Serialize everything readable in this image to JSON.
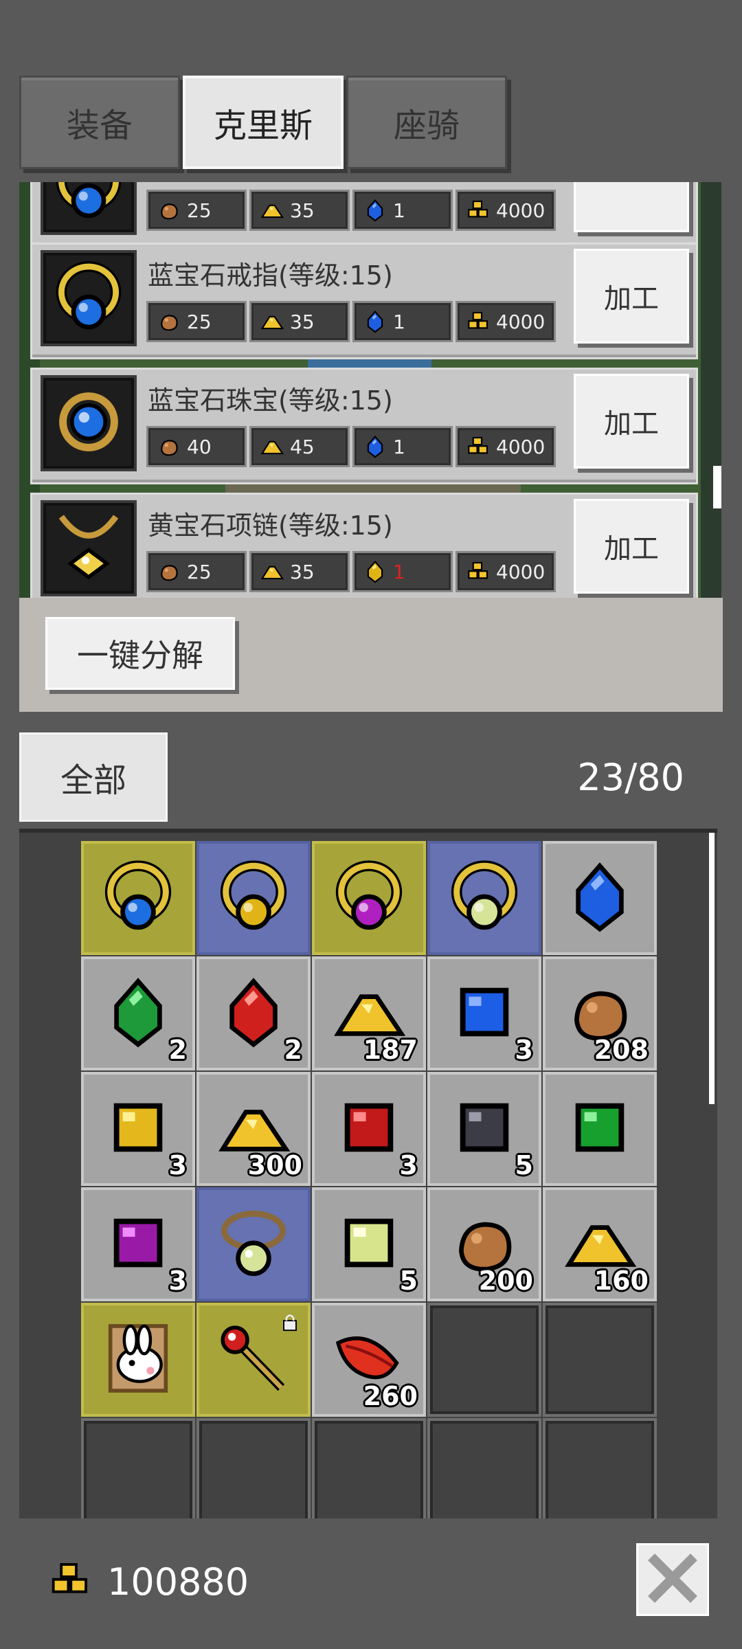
{
  "tabs": [
    {
      "label": "装备",
      "active": false
    },
    {
      "label": "克里斯",
      "active": true
    },
    {
      "label": "座骑",
      "active": false
    }
  ],
  "recipes": [
    {
      "title": "",
      "item_icon": "sapphire-ring-icon",
      "costs": [
        {
          "icon": "ore-icon",
          "value": "25"
        },
        {
          "icon": "gold-pile-icon",
          "value": "35"
        },
        {
          "icon": "blue-gem-icon",
          "value": "1"
        },
        {
          "icon": "gold-coins-icon",
          "value": "4000"
        }
      ]
    },
    {
      "title": "蓝宝石戒指(等级:15)",
      "item_icon": "sapphire-ring-icon",
      "button": "加工",
      "costs": [
        {
          "icon": "ore-icon",
          "value": "25"
        },
        {
          "icon": "gold-pile-icon",
          "value": "35"
        },
        {
          "icon": "blue-gem-icon",
          "value": "1"
        },
        {
          "icon": "gold-coins-icon",
          "value": "4000"
        }
      ]
    },
    {
      "title": "蓝宝石珠宝(等级:15)",
      "item_icon": "sapphire-jewel-icon",
      "button": "加工",
      "costs": [
        {
          "icon": "ore-icon",
          "value": "40"
        },
        {
          "icon": "gold-pile-icon",
          "value": "45"
        },
        {
          "icon": "blue-gem-icon",
          "value": "1"
        },
        {
          "icon": "gold-coins-icon",
          "value": "4000"
        }
      ]
    },
    {
      "title": "黄宝石项链(等级:15)",
      "item_icon": "topaz-necklace-icon",
      "button": "加工",
      "costs": [
        {
          "icon": "ore-icon",
          "value": "25"
        },
        {
          "icon": "gold-pile-icon",
          "value": "35"
        },
        {
          "icon": "yellow-gem-icon",
          "value": "1",
          "insufficient": true
        },
        {
          "icon": "gold-coins-icon",
          "value": "4000"
        }
      ]
    }
  ],
  "decompose_button": "一键分解",
  "filter_button": "全部",
  "capacity": "23/80",
  "inventory": [
    {
      "icon": "sapphire-ring-icon",
      "frame": "olive",
      "count": ""
    },
    {
      "icon": "topaz-ring-icon",
      "frame": "blue",
      "count": ""
    },
    {
      "icon": "amethyst-ring-icon",
      "frame": "olive",
      "count": ""
    },
    {
      "icon": "peridot-ring-icon",
      "frame": "blue",
      "count": ""
    },
    {
      "icon": "blue-gem-icon",
      "frame": "grey",
      "count": ""
    },
    {
      "icon": "green-gem-icon",
      "frame": "grey",
      "count": "2"
    },
    {
      "icon": "red-gem-icon",
      "frame": "grey",
      "count": "2"
    },
    {
      "icon": "gold-pile-icon",
      "frame": "grey",
      "count": "187"
    },
    {
      "icon": "blue-cube-icon",
      "frame": "grey",
      "count": "3"
    },
    {
      "icon": "ore-icon",
      "frame": "grey",
      "count": "208"
    },
    {
      "icon": "yellow-cube-icon",
      "frame": "grey",
      "count": "3"
    },
    {
      "icon": "gold-pile-icon",
      "frame": "grey",
      "count": "300"
    },
    {
      "icon": "red-cube-icon",
      "frame": "grey",
      "count": "3"
    },
    {
      "icon": "black-cube-icon",
      "frame": "grey",
      "count": "5"
    },
    {
      "icon": "green-cube-icon",
      "frame": "grey",
      "count": ""
    },
    {
      "icon": "purple-cube-icon",
      "frame": "grey",
      "count": "3"
    },
    {
      "icon": "peridot-necklace-icon",
      "frame": "blue",
      "count": ""
    },
    {
      "icon": "lime-cube-icon",
      "frame": "grey",
      "count": "5"
    },
    {
      "icon": "ore-icon",
      "frame": "grey",
      "count": "200"
    },
    {
      "icon": "gold-pile-icon",
      "frame": "grey",
      "count": "160"
    },
    {
      "icon": "rabbit-card-icon",
      "frame": "olive",
      "count": ""
    },
    {
      "icon": "ruby-scepter-icon",
      "frame": "olive",
      "count": "",
      "locked": true
    },
    {
      "icon": "red-feather-icon",
      "frame": "grey",
      "count": "260"
    },
    {
      "icon": "",
      "frame": "empty",
      "count": ""
    },
    {
      "icon": "",
      "frame": "empty",
      "count": ""
    },
    {
      "icon": "",
      "frame": "empty",
      "count": ""
    },
    {
      "icon": "",
      "frame": "empty",
      "count": ""
    },
    {
      "icon": "",
      "frame": "empty",
      "count": ""
    },
    {
      "icon": "",
      "frame": "empty",
      "count": ""
    },
    {
      "icon": "",
      "frame": "empty",
      "count": ""
    }
  ],
  "footer": {
    "gold_icon": "gold-coins-icon",
    "gold_amount": "100880",
    "close_icon": "close-icon"
  },
  "colors": {
    "background": "#595959",
    "active_tab": "#e5e5e5",
    "olive_frame": "#a7a43a",
    "blue_frame": "#6672b1",
    "insufficient": "#d22"
  }
}
